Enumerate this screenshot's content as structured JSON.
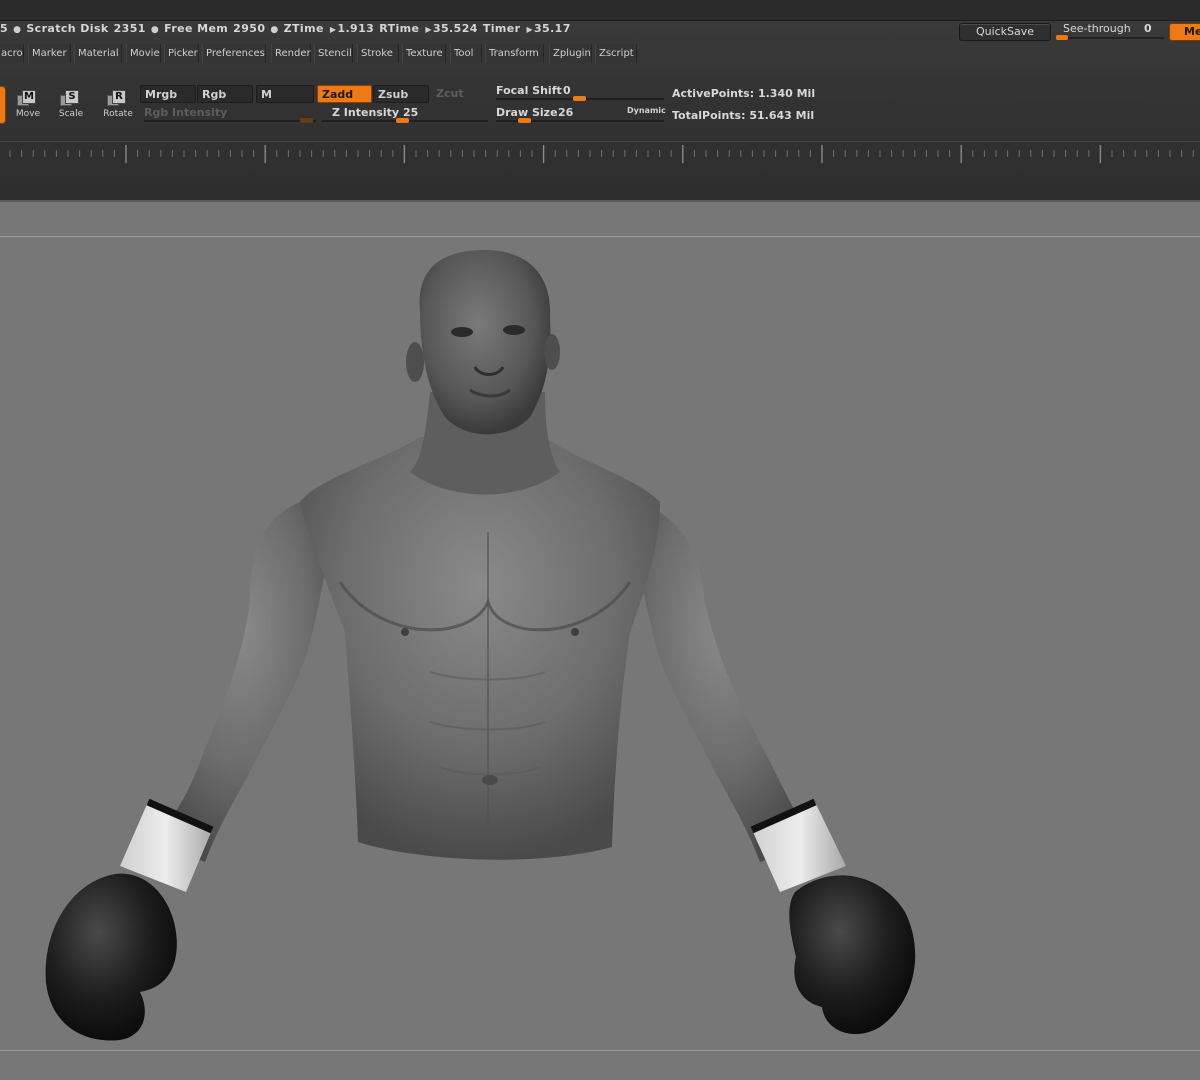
{
  "status_bar": {
    "prefix": "5",
    "scratch_disk_label": "Scratch Disk",
    "scratch_disk_value": "2351",
    "free_mem_label": "Free Mem",
    "free_mem_value": "2950",
    "ztime_label": "ZTime",
    "ztime_value": "1.913",
    "rtime_label": "RTime",
    "rtime_value": "35.524",
    "timer_label": "Timer",
    "timer_value": "35.17"
  },
  "header_right": {
    "quicksave_label": "QuickSave",
    "seethrough_label": "See-through",
    "seethrough_value": "0",
    "menus_label": "Menus"
  },
  "menu": {
    "items": [
      "acro",
      "Marker",
      "Material",
      "Movie",
      "Picker",
      "Preferences",
      "Render",
      "Stencil",
      "Stroke",
      "Texture",
      "Tool",
      "Transform",
      "Zplugin",
      "Zscript"
    ]
  },
  "tools": {
    "move": {
      "letter": "M",
      "label": "Move"
    },
    "scale": {
      "letter": "S",
      "label": "Scale"
    },
    "rotate": {
      "letter": "R",
      "label": "Rotate"
    }
  },
  "modes": {
    "mrgb": "Mrgb",
    "rgb": "Rgb",
    "m": "M",
    "zadd": "Zadd",
    "zsub": "Zsub",
    "zcut": "Zcut"
  },
  "sliders": {
    "rgb_intensity_label": "Rgb Intensity",
    "z_intensity_label": "Z Intensity",
    "z_intensity_value": "25",
    "focal_shift_label": "Focal Shift",
    "focal_shift_value": "0",
    "draw_size_label": "Draw Size",
    "draw_size_value": "26",
    "dynamic_label": "Dynamic"
  },
  "stats": {
    "active_points_label": "ActivePoints:",
    "active_points_value": "1.340",
    "active_points_unit": "Mil",
    "total_points_label": "TotalPoints:",
    "total_points_value": "51.643",
    "total_points_unit": "Mil"
  },
  "colors": {
    "accent": "#ef7a14",
    "chrome_bg": "#333333",
    "canvas_bg": "#777777"
  }
}
